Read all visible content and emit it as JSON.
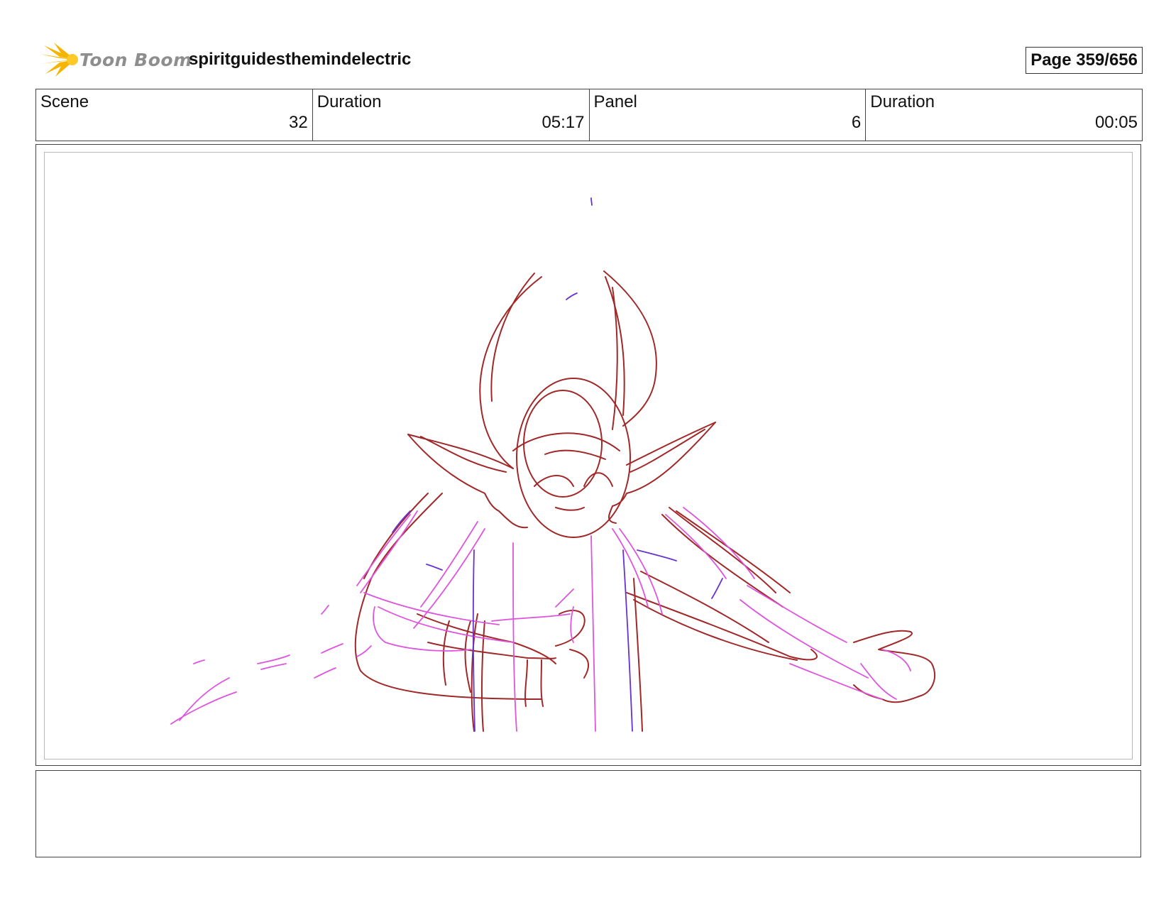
{
  "brand": {
    "logo_text": "Toon Boom",
    "logo_color": "#f5b400"
  },
  "project": {
    "title": "spiritguidesthemindelectric"
  },
  "page": {
    "label": "Page 359/656"
  },
  "info": {
    "scene_label": "Scene",
    "scene_value": "32",
    "scene_duration_label": "Duration",
    "scene_duration_value": "05:17",
    "panel_label": "Panel",
    "panel_value": "6",
    "panel_duration_label": "Duration",
    "panel_duration_value": "00:05"
  },
  "panel_image": {
    "description_icon": "sketch-drawing",
    "stroke_colors": [
      "#a02828",
      "#dd55dd",
      "#6633cc"
    ]
  },
  "notes": {
    "text": ""
  }
}
